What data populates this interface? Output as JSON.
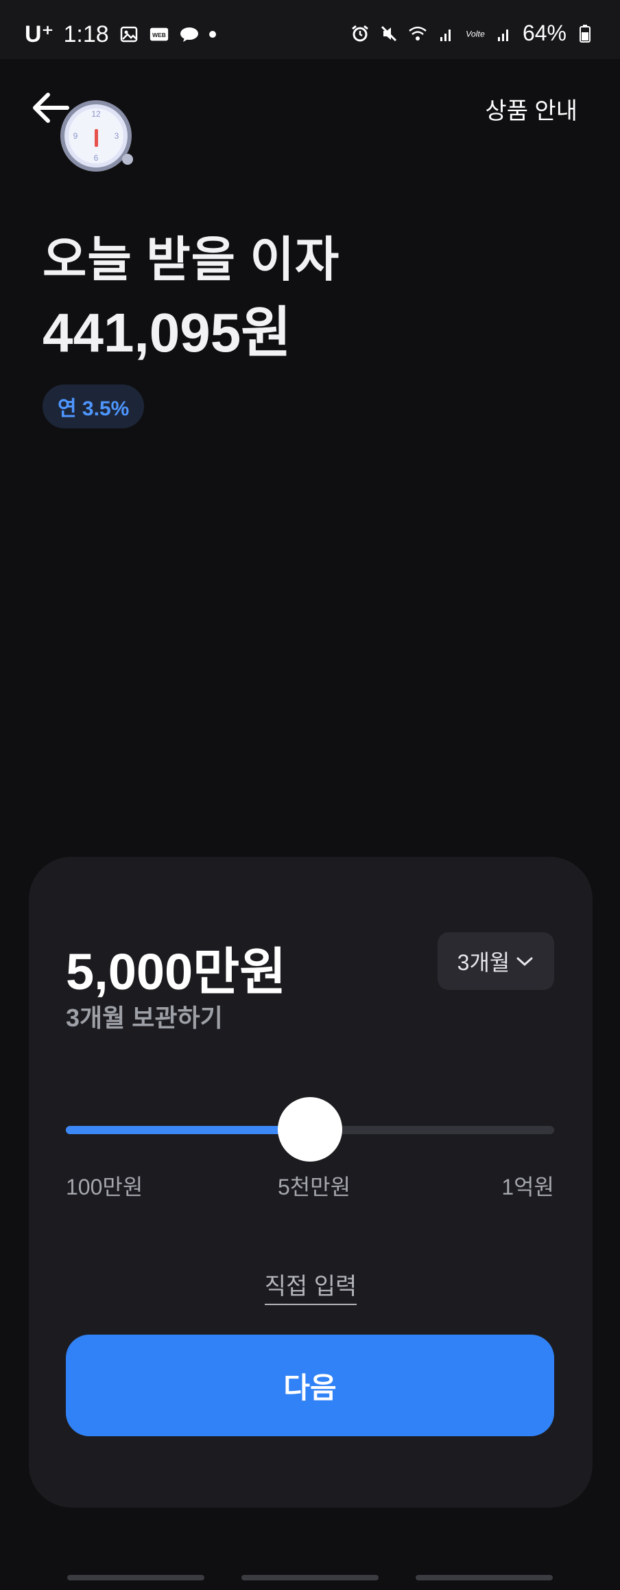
{
  "status_bar": {
    "carrier": "U⁺",
    "time": "1:18",
    "battery": "64%",
    "left_icons": [
      "gallery-icon",
      "webtoon-icon",
      "messenger-icon",
      "notification-dot-icon"
    ],
    "right_icons": [
      "alarm-icon",
      "mute-icon",
      "wifi-icon",
      "signal-icon",
      "volte-icon",
      "signal-icon",
      "battery-icon"
    ]
  },
  "header": {
    "back_icon": "arrow-left-icon",
    "guide_label": "상품 안내"
  },
  "hero": {
    "title": "오늘 받을 이자",
    "amount": "441,095원",
    "rate_badge": "연 3.5%"
  },
  "card": {
    "deposit_amount": "5,000만원",
    "period_button": "3개월",
    "subtext": "3개월 보관하기",
    "slider": {
      "min_label": "100만원",
      "mid_label": "5천만원",
      "max_label": "1억원",
      "position_fraction": 0.5
    },
    "direct_input": "직접 입력",
    "next_button": "다음"
  },
  "colors": {
    "accent": "#3182f6",
    "background": "#0f0f11",
    "card": "#1c1c20"
  }
}
